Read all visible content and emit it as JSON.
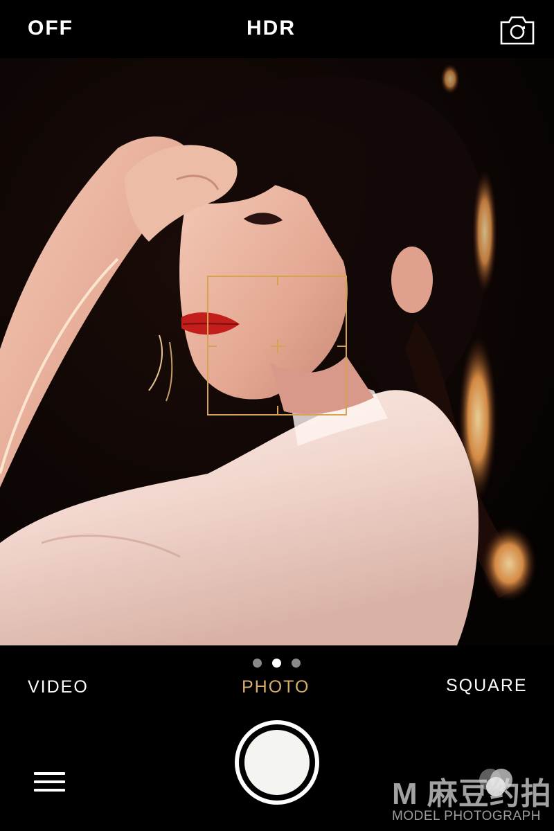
{
  "top_bar": {
    "flash_label": "OFF",
    "hdr_label": "HDR",
    "switch_camera_icon": "camera-switch-icon"
  },
  "viewfinder": {
    "focus_indicator_color": "#d7a352"
  },
  "modes": {
    "items": [
      "VIDEO",
      "PHOTO",
      "SQUARE"
    ],
    "selected": "PHOTO",
    "selected_color": "#d8ae6c",
    "page_indicator": {
      "count": 3,
      "active_index": 1
    }
  },
  "controls": {
    "menu_icon": "hamburger-menu-icon",
    "shutter_icon": "shutter-button",
    "filter_icon": "filter-circles-icon"
  },
  "watermark": {
    "main": "M 麻豆约拍",
    "sub": "MODEL PHOTOGRAPH"
  }
}
